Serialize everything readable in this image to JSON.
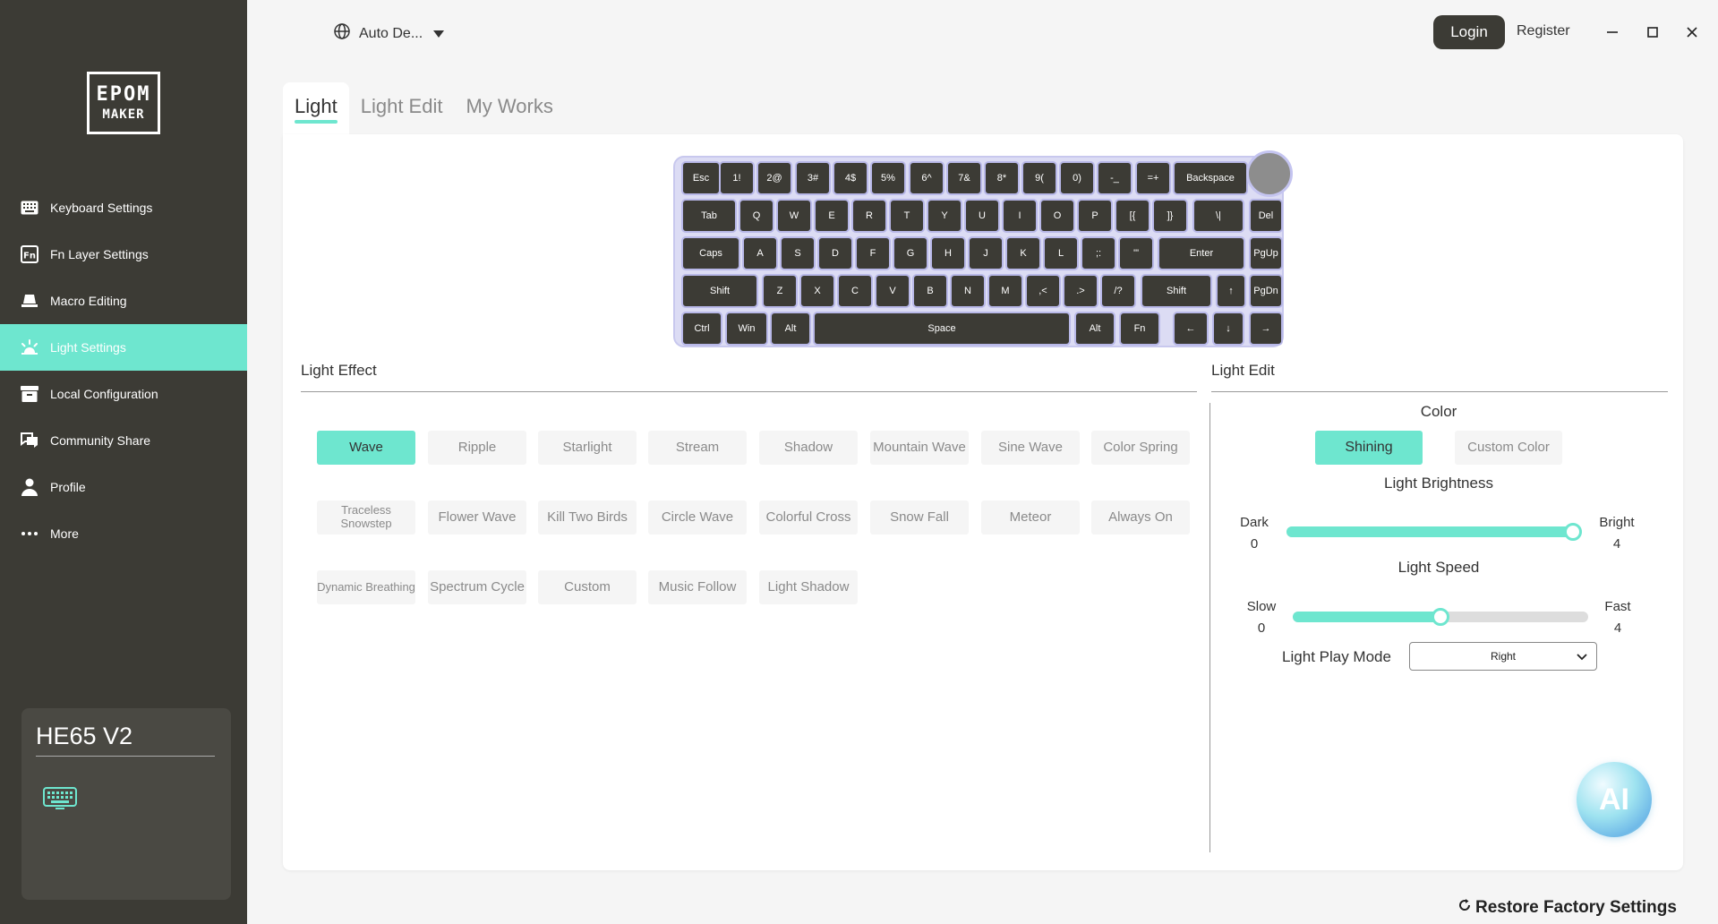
{
  "brand": {
    "logo_line1": "EPOM",
    "logo_line2": "MAKER"
  },
  "sidebar": {
    "items": [
      {
        "label": "Keyboard Settings",
        "icon": "keyboard-icon"
      },
      {
        "label": "Fn Layer Settings",
        "icon": "fn-icon"
      },
      {
        "label": "Macro Editing",
        "icon": "macro-icon"
      },
      {
        "label": "Light Settings",
        "icon": "light-icon",
        "active": true
      },
      {
        "label": "Local Configuration",
        "icon": "archive-icon"
      },
      {
        "label": "Community Share",
        "icon": "chat-icon"
      },
      {
        "label": "Profile",
        "icon": "user-icon"
      },
      {
        "label": "More",
        "icon": "more-icon"
      }
    ],
    "device": {
      "name": "HE65 V2",
      "icon": "keyboard-icon"
    }
  },
  "topbar": {
    "language": "Auto De...",
    "login": "Login",
    "register": "Register"
  },
  "tabs": [
    "Light",
    "Light Edit",
    "My Works"
  ],
  "keyboard": {
    "rows": [
      [
        "Esc",
        "1!",
        "2@",
        "3#",
        "4$",
        "5%",
        "6^",
        "7&",
        "8*",
        "9(",
        "0)",
        "-_",
        "=+",
        "Backspace"
      ],
      [
        "Tab",
        "Q",
        "W",
        "E",
        "R",
        "T",
        "Y",
        "U",
        "I",
        "O",
        "P",
        "[{",
        "]}",
        "\\|",
        "Del"
      ],
      [
        "Caps",
        "A",
        "S",
        "D",
        "F",
        "G",
        "H",
        "J",
        "K",
        "L",
        ";:",
        "'\"",
        "Enter",
        "PgUp"
      ],
      [
        "Shift",
        "Z",
        "X",
        "C",
        "V",
        "B",
        "N",
        "M",
        ",<",
        ".>",
        "/?",
        "Shift",
        "↑",
        "PgDn"
      ],
      [
        "Ctrl",
        "Win",
        "Alt",
        "Space",
        "Alt",
        "Fn",
        "←",
        "↓",
        "→"
      ]
    ]
  },
  "light_effect": {
    "title": "Light Effect",
    "effects": [
      "Wave",
      "Ripple",
      "Starlight",
      "Stream",
      "Shadow",
      "Mountain Wave",
      "Sine Wave",
      "Color Spring",
      "Traceless Snowstep",
      "Flower Wave",
      "Kill Two Birds",
      "Circle Wave",
      "Colorful Cross",
      "Snow Fall",
      "Meteor",
      "Always On",
      "Dynamic Breathing",
      "Spectrum Cycle",
      "Custom",
      "Music Follow",
      "Light Shadow"
    ],
    "selected": "Wave"
  },
  "light_edit": {
    "title": "Light Edit",
    "color_label": "Color",
    "shining": "Shining",
    "custom_color": "Custom Color",
    "brightness": {
      "label": "Light Brightness",
      "min_label": "Dark",
      "max_label": "Bright",
      "min": "0",
      "max": "4",
      "value": 4
    },
    "speed": {
      "label": "Light Speed",
      "min_label": "Slow",
      "max_label": "Fast",
      "min": "0",
      "max": "4",
      "value": 2
    },
    "play_mode_label": "Light Play Mode",
    "play_mode_value": "Right"
  },
  "ai_label": "AI",
  "restore_label": "Restore Factory Settings",
  "colors": {
    "accent": "#6ee6cf",
    "sidebar": "#3c3b35",
    "key": "#3c3b35"
  }
}
